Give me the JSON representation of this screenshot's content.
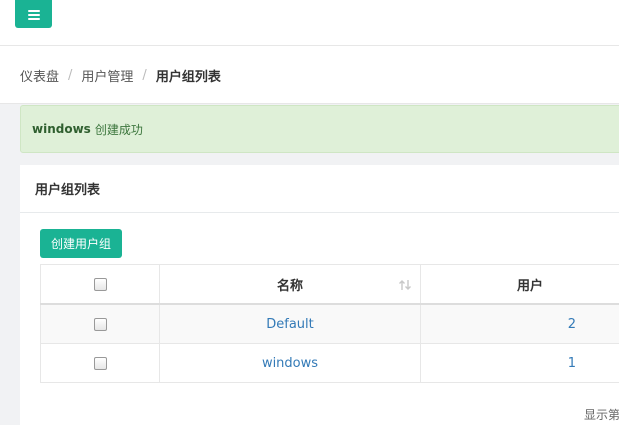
{
  "breadcrumb": {
    "items": [
      "仪表盘",
      "用户管理"
    ],
    "current": "用户组列表",
    "separator": "/"
  },
  "alert": {
    "name": "windows",
    "message": "创建成功"
  },
  "panel": {
    "title": "用户组列表",
    "create_button": "创建用户组"
  },
  "table": {
    "columns": [
      "名称",
      "用户"
    ],
    "rows": [
      {
        "name": "Default",
        "users": "2"
      },
      {
        "name": "windows",
        "users": "1"
      }
    ]
  },
  "footer": {
    "pager_text": "显示第"
  },
  "icons": {
    "menu": "hamburger-menu-icon",
    "sort": "sort-icon",
    "checkbox": "checkbox"
  },
  "colors": {
    "accent": "#1ab394",
    "alert_bg": "#dff0d8",
    "link": "#337ab7"
  }
}
